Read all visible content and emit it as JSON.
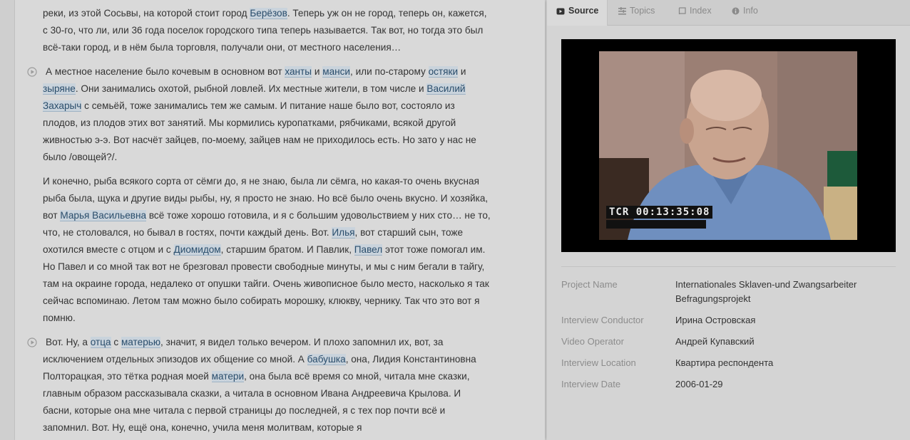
{
  "transcript": {
    "p1": [
      {
        "t": "реки, из этой Сосьвы, на которой стоит город "
      },
      {
        "t": "Берёзов",
        "tag": true
      },
      {
        "t": ". Теперь уж он не город, теперь он, кажется, с 30-го, что ли, или 36 года поселок городского типа теперь называется. Так вот, но тогда это был всё-таки город, и в нём была торговля, получали они, от местного населения…"
      }
    ],
    "p2": [
      {
        "t": "А местное население было кочевым в основном вот "
      },
      {
        "t": "ханты",
        "tag": true
      },
      {
        "t": " и "
      },
      {
        "t": "манси",
        "tag": true
      },
      {
        "t": ", или по-старому "
      },
      {
        "t": "остяки",
        "tag": true
      },
      {
        "t": " и "
      },
      {
        "t": "зыряне",
        "tag": true
      },
      {
        "t": ". Они занимались охотой, рыбной ловлей. Их местные жители, в том числе и "
      },
      {
        "t": "Василий Захарыч",
        "tag": true
      },
      {
        "t": " с семьёй, тоже занимались тем же самым. И питание наше было вот, состояло из плодов, из плодов этих вот занятий. Мы кормились куропатками, рябчиками, всякой другой живностью э-э. Вот насчёт зайцев, по-моему, зайцев нам не приходилось есть. Но зато у нас не было /овощей?/."
      }
    ],
    "p3": [
      {
        "t": "И конечно, рыба всякого сорта от сёмги до, я не знаю, была ли сёмга, но какая-то очень вкусная рыба была, щука и другие виды рыбы, ну, я просто не знаю. Но всё было очень вкусно. И хозяйка, вот "
      },
      {
        "t": "Марья Васильевна",
        "tag": true
      },
      {
        "t": " всё тоже хорошо готовила, и я с большим удовольствием у них сто… не то, что, не столовался, но бывал в гостях, почти каждый день. Вот. "
      },
      {
        "t": "Илья",
        "tag": true
      },
      {
        "t": ", вот старший сын, тоже охотился вместе с отцом и с "
      },
      {
        "t": "Диомидом",
        "tag": true
      },
      {
        "t": ", старшим братом. И Павлик, "
      },
      {
        "t": "Павел",
        "tag": true
      },
      {
        "t": " этот тоже помогал им. Но Павел и со мной так вот не брезговал провести свободные минуты, и мы с ним бегали в тайгу, там на окраине города, недалеко от опушки тайги. Очень живописное было место, насколько я так сейчас вспоминаю. Летом там можно было собирать морошку, клюкву, чернику. Так что это вот я помню."
      }
    ],
    "p4": [
      {
        "t": "Вот. Ну, а "
      },
      {
        "t": "отца",
        "tag": true
      },
      {
        "t": " с "
      },
      {
        "t": "матерью",
        "tag": true
      },
      {
        "t": ", значит, я видел только вечером. И плохо запомнил их, вот, за исключением отдельных эпизодов их общение со мной. А "
      },
      {
        "t": "бабушка",
        "tag": true
      },
      {
        "t": ", она, Лидия Константиновна Полторацкая, это тётка родная моей "
      },
      {
        "t": "матери",
        "tag": true
      },
      {
        "t": ", она была всё время со мной, читала мне сказки, главным образом рассказывала сказки, а читала в основном Ивана Андреевича Крылова. И басни, которые она мне читала с первой страницы до последней, я с тех пор почти всё и запомнил. Вот. Ну, ещё она, конечно, учила меня молитвам, которые я"
      }
    ]
  },
  "tabs": {
    "source": "Source",
    "topics": "Topics",
    "index": "Index",
    "info": "Info"
  },
  "video": {
    "timecode": "TCR 00:13:35:08"
  },
  "metadata": {
    "project_name_label": "Project Name",
    "project_name_value": "Internationales Sklaven-und Zwangsarbeiter Befragungsprojekt",
    "conductor_label": "Interview Conductor",
    "conductor_value": "Ирина Островская",
    "operator_label": "Video Operator",
    "operator_value": "Андрей Купавский",
    "location_label": "Interview Location",
    "location_value": "Квартира респондента",
    "date_label": "Interview Date",
    "date_value": "2006-01-29"
  },
  "colors": {
    "tag_background": "#c9d3dc",
    "tag_text": "#2a4d6b"
  },
  "icons": {
    "source": "video-icon",
    "topics": "topics-icon",
    "index": "book-icon",
    "info": "info-icon",
    "segment": "play-circle-icon"
  }
}
